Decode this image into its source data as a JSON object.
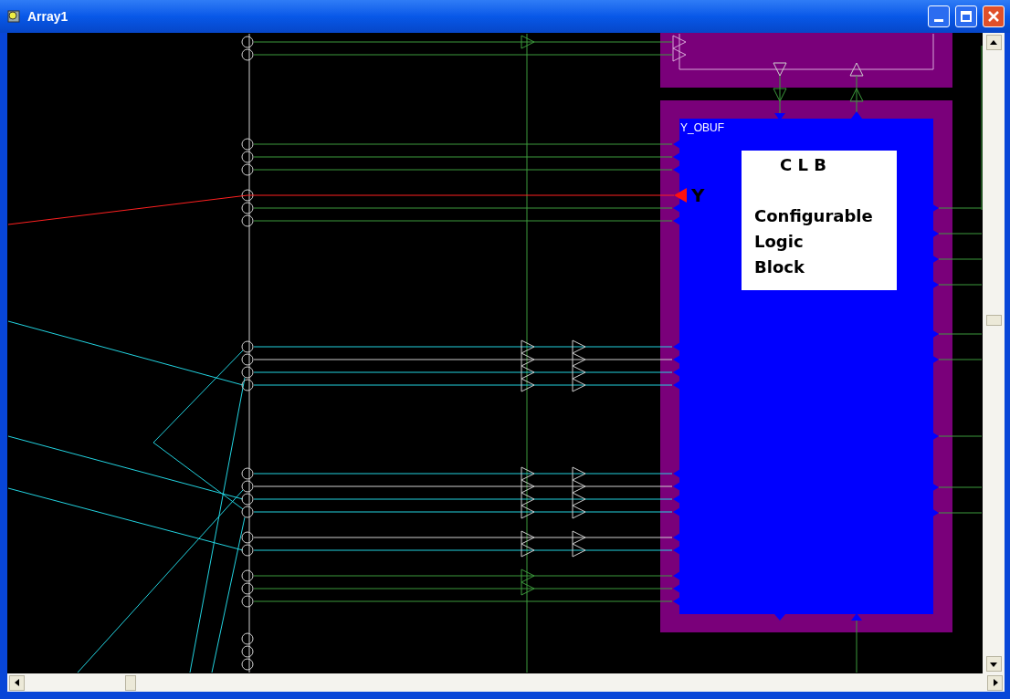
{
  "window": {
    "title": "Array1"
  },
  "canvas": {
    "instance_label": "Y_OBUF",
    "pin_label": "Y",
    "block_label": {
      "title": "C L B",
      "lines": [
        "Configurable",
        "Logic",
        "Block"
      ]
    }
  }
}
